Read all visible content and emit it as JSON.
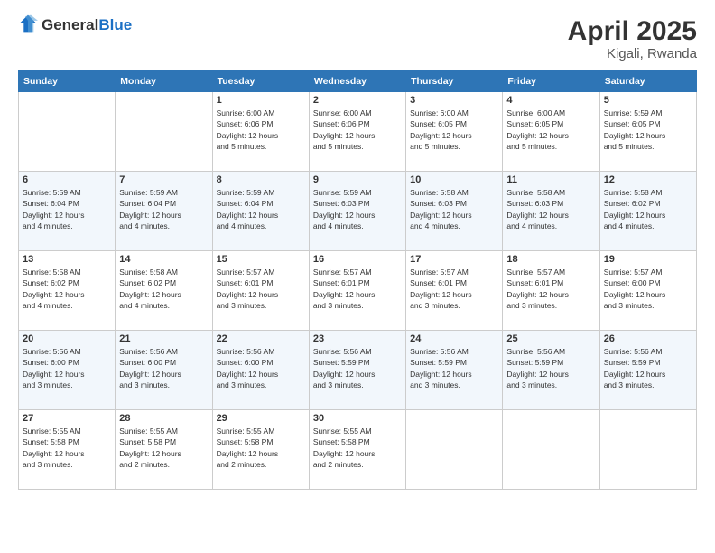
{
  "logo": {
    "general": "General",
    "blue": "Blue"
  },
  "title": "April 2025",
  "subtitle": "Kigali, Rwanda",
  "days_of_week": [
    "Sunday",
    "Monday",
    "Tuesday",
    "Wednesday",
    "Thursday",
    "Friday",
    "Saturday"
  ],
  "weeks": [
    [
      {
        "day": "",
        "info": ""
      },
      {
        "day": "",
        "info": ""
      },
      {
        "day": "1",
        "info": "Sunrise: 6:00 AM\nSunset: 6:06 PM\nDaylight: 12 hours\nand 5 minutes."
      },
      {
        "day": "2",
        "info": "Sunrise: 6:00 AM\nSunset: 6:06 PM\nDaylight: 12 hours\nand 5 minutes."
      },
      {
        "day": "3",
        "info": "Sunrise: 6:00 AM\nSunset: 6:05 PM\nDaylight: 12 hours\nand 5 minutes."
      },
      {
        "day": "4",
        "info": "Sunrise: 6:00 AM\nSunset: 6:05 PM\nDaylight: 12 hours\nand 5 minutes."
      },
      {
        "day": "5",
        "info": "Sunrise: 5:59 AM\nSunset: 6:05 PM\nDaylight: 12 hours\nand 5 minutes."
      }
    ],
    [
      {
        "day": "6",
        "info": "Sunrise: 5:59 AM\nSunset: 6:04 PM\nDaylight: 12 hours\nand 4 minutes."
      },
      {
        "day": "7",
        "info": "Sunrise: 5:59 AM\nSunset: 6:04 PM\nDaylight: 12 hours\nand 4 minutes."
      },
      {
        "day": "8",
        "info": "Sunrise: 5:59 AM\nSunset: 6:04 PM\nDaylight: 12 hours\nand 4 minutes."
      },
      {
        "day": "9",
        "info": "Sunrise: 5:59 AM\nSunset: 6:03 PM\nDaylight: 12 hours\nand 4 minutes."
      },
      {
        "day": "10",
        "info": "Sunrise: 5:58 AM\nSunset: 6:03 PM\nDaylight: 12 hours\nand 4 minutes."
      },
      {
        "day": "11",
        "info": "Sunrise: 5:58 AM\nSunset: 6:03 PM\nDaylight: 12 hours\nand 4 minutes."
      },
      {
        "day": "12",
        "info": "Sunrise: 5:58 AM\nSunset: 6:02 PM\nDaylight: 12 hours\nand 4 minutes."
      }
    ],
    [
      {
        "day": "13",
        "info": "Sunrise: 5:58 AM\nSunset: 6:02 PM\nDaylight: 12 hours\nand 4 minutes."
      },
      {
        "day": "14",
        "info": "Sunrise: 5:58 AM\nSunset: 6:02 PM\nDaylight: 12 hours\nand 4 minutes."
      },
      {
        "day": "15",
        "info": "Sunrise: 5:57 AM\nSunset: 6:01 PM\nDaylight: 12 hours\nand 3 minutes."
      },
      {
        "day": "16",
        "info": "Sunrise: 5:57 AM\nSunset: 6:01 PM\nDaylight: 12 hours\nand 3 minutes."
      },
      {
        "day": "17",
        "info": "Sunrise: 5:57 AM\nSunset: 6:01 PM\nDaylight: 12 hours\nand 3 minutes."
      },
      {
        "day": "18",
        "info": "Sunrise: 5:57 AM\nSunset: 6:01 PM\nDaylight: 12 hours\nand 3 minutes."
      },
      {
        "day": "19",
        "info": "Sunrise: 5:57 AM\nSunset: 6:00 PM\nDaylight: 12 hours\nand 3 minutes."
      }
    ],
    [
      {
        "day": "20",
        "info": "Sunrise: 5:56 AM\nSunset: 6:00 PM\nDaylight: 12 hours\nand 3 minutes."
      },
      {
        "day": "21",
        "info": "Sunrise: 5:56 AM\nSunset: 6:00 PM\nDaylight: 12 hours\nand 3 minutes."
      },
      {
        "day": "22",
        "info": "Sunrise: 5:56 AM\nSunset: 6:00 PM\nDaylight: 12 hours\nand 3 minutes."
      },
      {
        "day": "23",
        "info": "Sunrise: 5:56 AM\nSunset: 5:59 PM\nDaylight: 12 hours\nand 3 minutes."
      },
      {
        "day": "24",
        "info": "Sunrise: 5:56 AM\nSunset: 5:59 PM\nDaylight: 12 hours\nand 3 minutes."
      },
      {
        "day": "25",
        "info": "Sunrise: 5:56 AM\nSunset: 5:59 PM\nDaylight: 12 hours\nand 3 minutes."
      },
      {
        "day": "26",
        "info": "Sunrise: 5:56 AM\nSunset: 5:59 PM\nDaylight: 12 hours\nand 3 minutes."
      }
    ],
    [
      {
        "day": "27",
        "info": "Sunrise: 5:55 AM\nSunset: 5:58 PM\nDaylight: 12 hours\nand 3 minutes."
      },
      {
        "day": "28",
        "info": "Sunrise: 5:55 AM\nSunset: 5:58 PM\nDaylight: 12 hours\nand 2 minutes."
      },
      {
        "day": "29",
        "info": "Sunrise: 5:55 AM\nSunset: 5:58 PM\nDaylight: 12 hours\nand 2 minutes."
      },
      {
        "day": "30",
        "info": "Sunrise: 5:55 AM\nSunset: 5:58 PM\nDaylight: 12 hours\nand 2 minutes."
      },
      {
        "day": "",
        "info": ""
      },
      {
        "day": "",
        "info": ""
      },
      {
        "day": "",
        "info": ""
      }
    ]
  ]
}
